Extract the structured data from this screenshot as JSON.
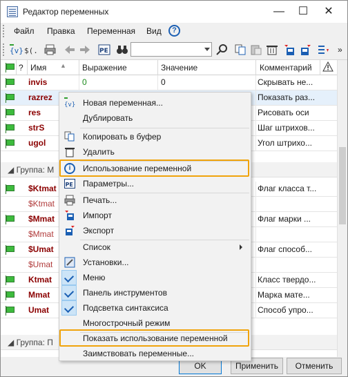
{
  "window": {
    "title": "Редактор переменных",
    "minimize": "—",
    "maximize": "☐",
    "close": "✕"
  },
  "menubar": {
    "items": [
      "Файл",
      "Правка",
      "Переменная",
      "Вид"
    ],
    "help": "?"
  },
  "toolbar": {
    "search_value": "",
    "more": "»"
  },
  "grid": {
    "headers": {
      "flag": "",
      "q": "?",
      "name": "Имя",
      "expr": "Выражение",
      "value": "Значение",
      "comment": "Комментарий"
    },
    "rows": [
      {
        "name": "invis",
        "expr": "0",
        "val": "0",
        "comment": "Скрывать не..."
      },
      {
        "name": "razrez",
        "expr": "",
        "val": "",
        "comment": "Показать раз..."
      },
      {
        "name": "res",
        "expr": "",
        "val": "",
        "comment": "Рисовать оси"
      },
      {
        "name": "strS",
        "expr": "",
        "val": "",
        "comment": "Шаг штрихов..."
      },
      {
        "name": "ugol",
        "expr": "",
        "val": "",
        "comment": "Угол штрихо..."
      }
    ],
    "group1": "Группа: M",
    "rows2": [
      {
        "name": "$Ktmat",
        "dim": false,
        "comment": "Флаг класса т..."
      },
      {
        "name": "$Ktmat",
        "dim": true,
        "comment": ""
      },
      {
        "name": "$Mmat",
        "dim": false,
        "comment": "Флаг марки ..."
      },
      {
        "name": "$Mmat",
        "dim": true,
        "comment": ""
      },
      {
        "name": "$Umat",
        "dim": false,
        "comment": "Флаг способ..."
      },
      {
        "name": "$Umat",
        "dim": true,
        "comment": ""
      },
      {
        "name": "Ktmat",
        "dim": false,
        "comment": "Класс твердо..."
      },
      {
        "name": "Mmat",
        "dim": false,
        "comment": "Марка мате..."
      },
      {
        "name": "Umat",
        "dim": false,
        "comment": "Способ упро..."
      }
    ],
    "group2": "Группа: П"
  },
  "buttons": {
    "ok": "OK",
    "apply": "Применить",
    "cancel": "Отменить"
  },
  "context_menu": {
    "items": [
      {
        "label": "Новая переменная...",
        "icon": "new-variable-icon"
      },
      {
        "label": "Дублировать",
        "icon": "duplicate-icon"
      },
      {
        "label": "Копировать в буфер",
        "icon": "copy-icon"
      },
      {
        "label": "Удалить",
        "icon": "delete-icon"
      },
      {
        "label": "Использование переменной",
        "icon": "info-icon"
      },
      {
        "label": "Параметры...",
        "icon": "parameters-icon"
      },
      {
        "label": "Печать...",
        "icon": "print-icon"
      },
      {
        "label": "Импорт",
        "icon": "import-icon"
      },
      {
        "label": "Экспорт",
        "icon": "export-icon"
      },
      {
        "label": "Список",
        "icon": ""
      },
      {
        "label": "Установки...",
        "icon": "settings-icon"
      },
      {
        "label": "Меню",
        "icon": "check-icon"
      },
      {
        "label": "Панель инструментов",
        "icon": "check-icon"
      },
      {
        "label": "Подсветка синтаксиса",
        "icon": "check-icon"
      },
      {
        "label": "Многострочный режим",
        "icon": ""
      },
      {
        "label": "Показать использование переменной",
        "icon": ""
      },
      {
        "label": "Заимствовать переменные...",
        "icon": ""
      }
    ]
  },
  "colors": {
    "highlight": "#f0a30a",
    "name_red": "#8b0000",
    "expr_green": "#1a8a1a",
    "check_blue": "#1b5fb3"
  }
}
